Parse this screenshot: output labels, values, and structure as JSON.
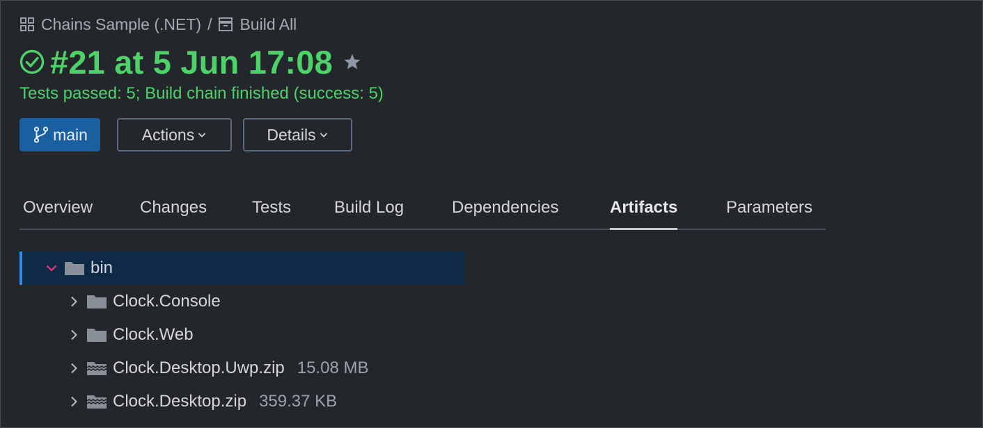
{
  "breadcrumb": {
    "project": "Chains Sample (.NET)",
    "separator": "/",
    "build_config": "Build All"
  },
  "build": {
    "title": "#21 at 5 Jun 17:08",
    "status": "Tests passed: 5; Build chain finished (success: 5)",
    "status_color": "#4dd26a"
  },
  "buttons": {
    "branch": "main",
    "actions": "Actions",
    "details": "Details"
  },
  "tabs": [
    {
      "label": "Overview"
    },
    {
      "label": "Changes"
    },
    {
      "label": "Tests"
    },
    {
      "label": "Build Log"
    },
    {
      "label": "Dependencies"
    },
    {
      "label": "Artifacts",
      "active": true
    },
    {
      "label": "Parameters"
    }
  ],
  "artifacts": {
    "root": {
      "name": "bin",
      "expanded": true,
      "icon": "folder-icon"
    },
    "children": [
      {
        "name": "Clock.Console",
        "icon": "folder-icon",
        "size": ""
      },
      {
        "name": "Clock.Web",
        "icon": "folder-icon",
        "size": ""
      },
      {
        "name": "Clock.Desktop.Uwp.zip",
        "icon": "zip-icon",
        "size": "15.08 MB"
      },
      {
        "name": "Clock.Desktop.zip",
        "icon": "zip-icon",
        "size": "359.37 KB"
      }
    ]
  },
  "colors": {
    "accent": "#1a5fa0",
    "selection": "#0f2a47",
    "selection_border": "#2d8ceb",
    "expand_arrow": "#e0317a"
  }
}
